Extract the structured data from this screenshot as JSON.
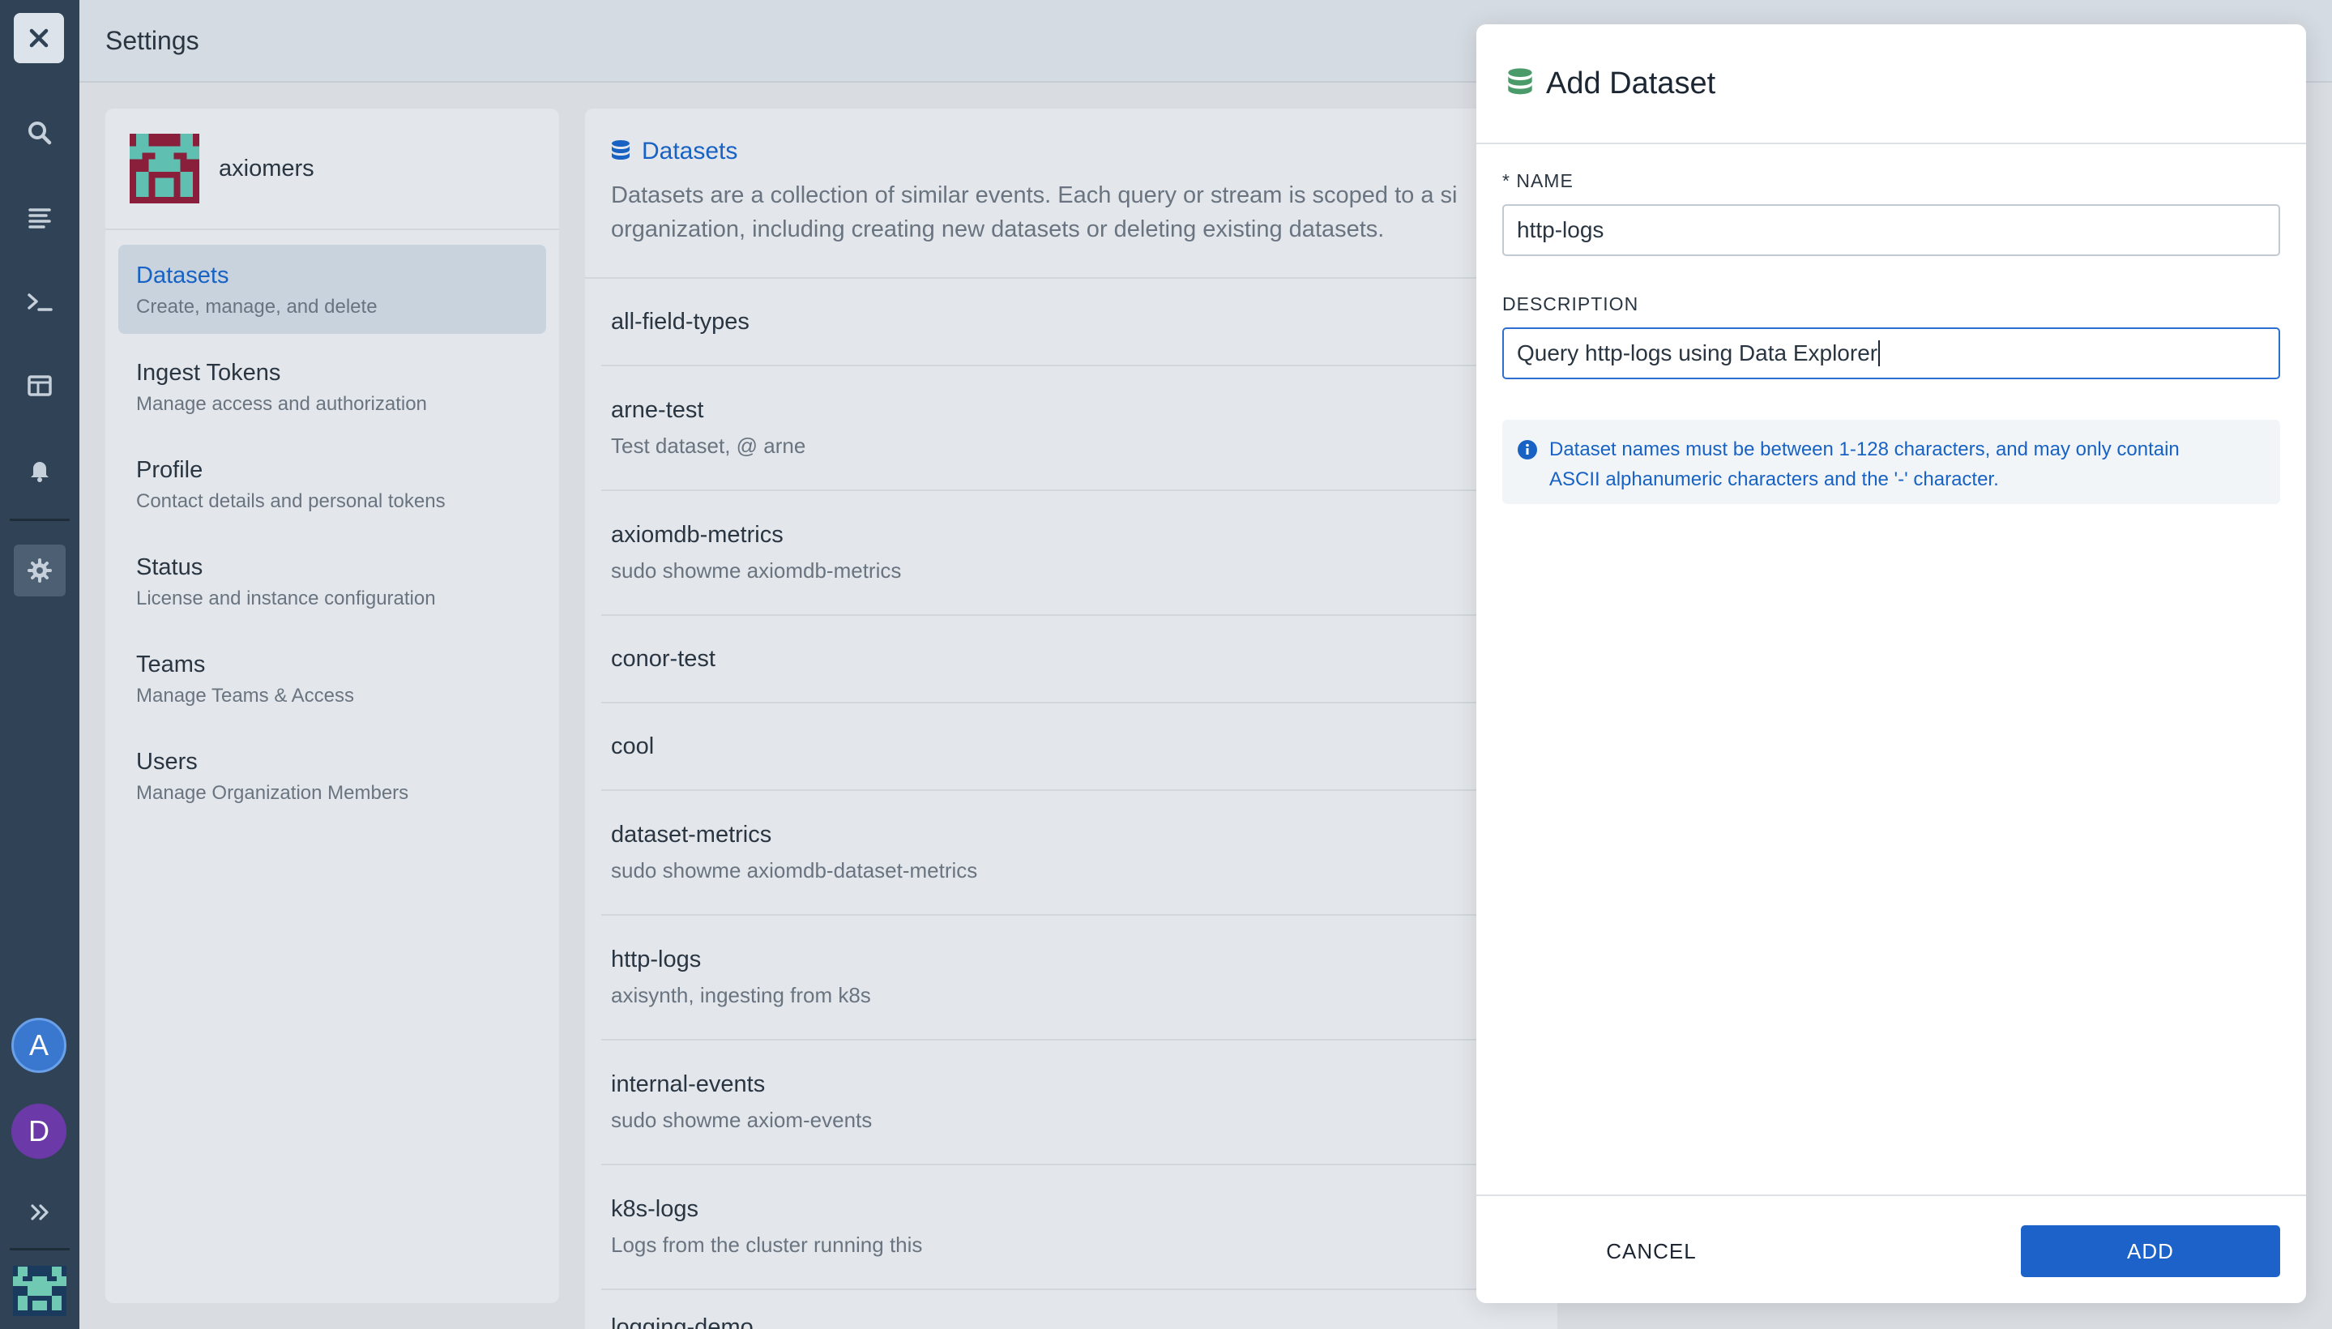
{
  "rail": {
    "icons": [
      "close-icon",
      "search-icon",
      "stream-icon",
      "terminal-icon",
      "dashboard-icon",
      "bell-icon",
      "gear-icon",
      "expand-icon"
    ],
    "avatars": [
      {
        "letter": "A",
        "color": "#3a78d0"
      },
      {
        "letter": "D",
        "color": "#6c3aa8"
      }
    ]
  },
  "topbar": {
    "title": "Settings"
  },
  "settings": {
    "org_name": "axiomers",
    "nav": [
      {
        "label": "Datasets",
        "sub": "Create, manage, and delete"
      },
      {
        "label": "Ingest Tokens",
        "sub": "Manage access and authorization"
      },
      {
        "label": "Profile",
        "sub": "Contact details and personal tokens"
      },
      {
        "label": "Status",
        "sub": "License and instance configuration"
      },
      {
        "label": "Teams",
        "sub": "Manage Teams & Access"
      },
      {
        "label": "Users",
        "sub": "Manage Organization Members"
      }
    ]
  },
  "datasets": {
    "title": "Datasets",
    "description_line1": "Datasets are a collection of similar events. Each query or stream is scoped to a si",
    "description_line2": "organization, including creating new datasets or deleting existing datasets.",
    "rows": [
      {
        "name": "all-field-types",
        "desc": ""
      },
      {
        "name": "arne-test",
        "desc": "Test dataset, @ arne"
      },
      {
        "name": "axiomdb-metrics",
        "desc": "sudo showme axiomdb-metrics"
      },
      {
        "name": "conor-test",
        "desc": ""
      },
      {
        "name": "cool",
        "desc": ""
      },
      {
        "name": "dataset-metrics",
        "desc": "sudo showme axiomdb-dataset-metrics"
      },
      {
        "name": "http-logs",
        "desc": "axisynth, ingesting from k8s"
      },
      {
        "name": "internal-events",
        "desc": "sudo showme axiom-events"
      },
      {
        "name": "k8s-logs",
        "desc": "Logs from the cluster running this"
      },
      {
        "name": "logging-demo",
        "desc": ""
      }
    ]
  },
  "drawer": {
    "title": "Add Dataset",
    "name_label": "* NAME",
    "name_value": "http-logs",
    "desc_label": "DESCRIPTION",
    "desc_value": "Query http-logs using Data Explorer",
    "info_line1": "Dataset names must be between 1-128 characters, and may only contain",
    "info_line2": "ASCII alphanumeric characters and the '-' character.",
    "cancel_label": "CANCEL",
    "add_label": "ADD"
  },
  "colors": {
    "accent": "#1d62c8",
    "rail": "#2f4256",
    "dataset_icon": "#4a9a6a"
  }
}
